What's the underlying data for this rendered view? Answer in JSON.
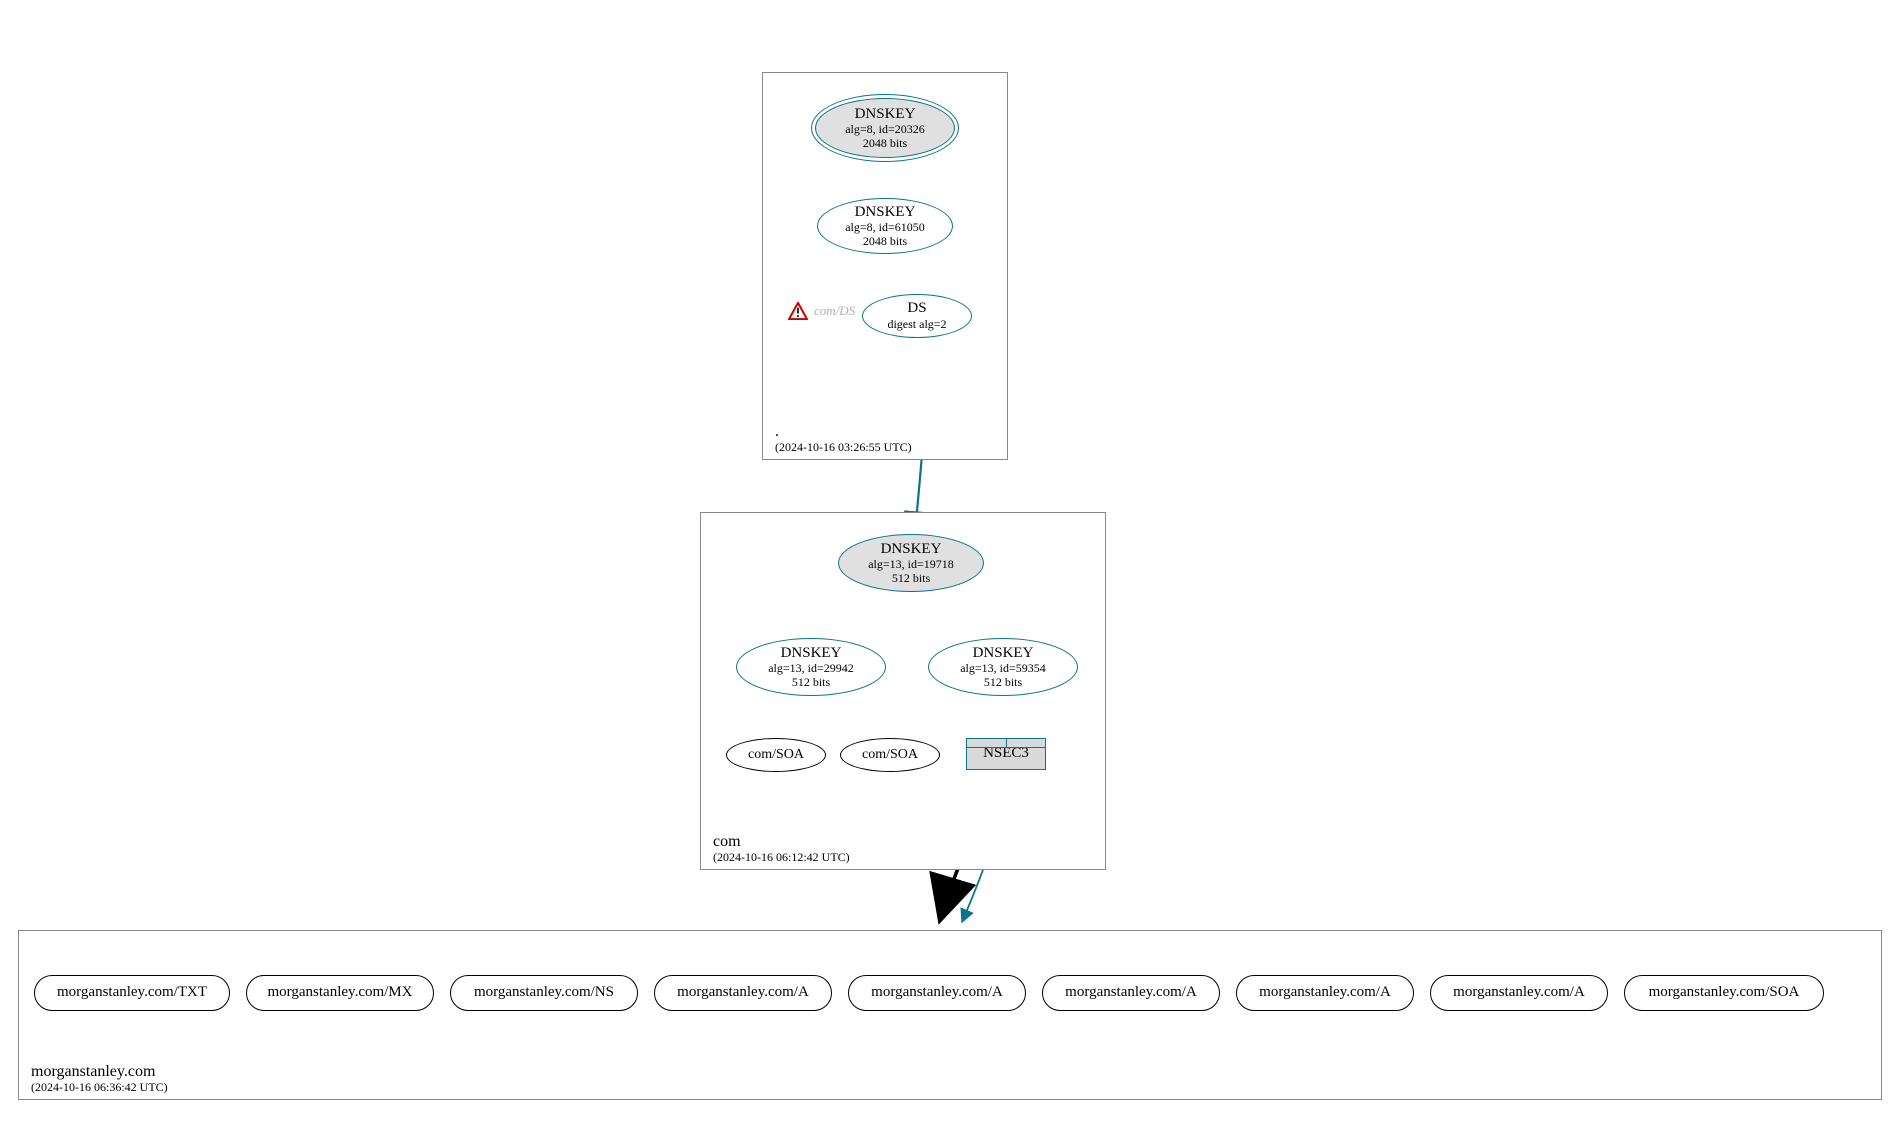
{
  "zones": {
    "root": {
      "name": ".",
      "timestamp": "(2024-10-16 03:26:55 UTC)"
    },
    "com": {
      "name": "com",
      "timestamp": "(2024-10-16 06:12:42 UTC)"
    },
    "leaf": {
      "name": "morganstanley.com",
      "timestamp": "(2024-10-16 06:36:42 UTC)"
    }
  },
  "nodes": {
    "root_ksk": {
      "title": "DNSKEY",
      "line1": "alg=8, id=20326",
      "line2": "2048 bits"
    },
    "root_zsk": {
      "title": "DNSKEY",
      "line1": "alg=8, id=61050",
      "line2": "2048 bits"
    },
    "root_ds": {
      "title": "DS",
      "line1": "digest alg=2"
    },
    "root_warn": {
      "label": "com/DS"
    },
    "com_ksk": {
      "title": "DNSKEY",
      "line1": "alg=13, id=19718",
      "line2": "512 bits"
    },
    "com_zsk1": {
      "title": "DNSKEY",
      "line1": "alg=13, id=29942",
      "line2": "512 bits"
    },
    "com_zsk2": {
      "title": "DNSKEY",
      "line1": "alg=13, id=59354",
      "line2": "512 bits"
    },
    "com_soa1": {
      "label": "com/SOA"
    },
    "com_soa2": {
      "label": "com/SOA"
    },
    "com_nsec3": {
      "label": "NSEC3"
    },
    "leaf_txt": {
      "label": "morganstanley.com/TXT"
    },
    "leaf_mx": {
      "label": "morganstanley.com/MX"
    },
    "leaf_ns": {
      "label": "morganstanley.com/NS"
    },
    "leaf_a1": {
      "label": "morganstanley.com/A"
    },
    "leaf_a2": {
      "label": "morganstanley.com/A"
    },
    "leaf_a3": {
      "label": "morganstanley.com/A"
    },
    "leaf_a4": {
      "label": "morganstanley.com/A"
    },
    "leaf_a5": {
      "label": "morganstanley.com/A"
    },
    "leaf_soa": {
      "label": "morganstanley.com/SOA"
    }
  }
}
